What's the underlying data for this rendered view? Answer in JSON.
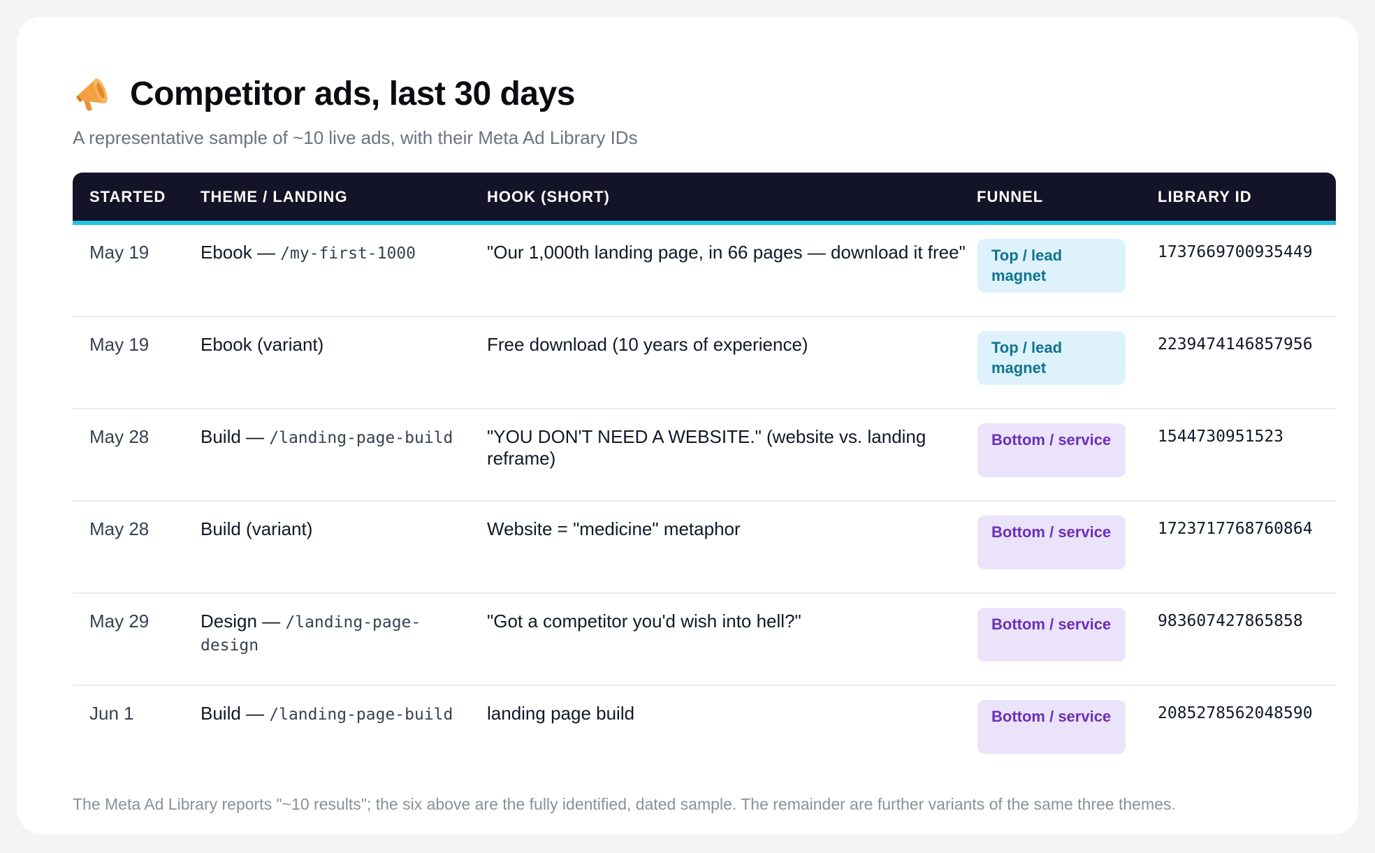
{
  "header": {
    "icon": "megaphone-icon",
    "title": "Competitor ads, last 30 days",
    "subtitle": "A representative sample of ~10 live ads, with their Meta Ad Library IDs"
  },
  "table": {
    "columns": [
      "STARTED",
      "THEME / LANDING",
      "HOOK (SHORT)",
      "FUNNEL",
      "LIBRARY ID"
    ],
    "rows": [
      {
        "started": "May 19",
        "theme": "Ebook — ",
        "landing": "/my-first-1000",
        "hook": "\"Our 1,000th landing page, in 66 pages — download it free\"",
        "funnel": "Top / lead magnet",
        "funnel_type": "top",
        "library_id": "1737669700935449"
      },
      {
        "started": "May 19",
        "theme": "Ebook (variant)",
        "landing": "",
        "hook": "Free download (10 years of experience)",
        "funnel": "Top / lead magnet",
        "funnel_type": "top",
        "library_id": "2239474146857956"
      },
      {
        "started": "May 28",
        "theme": "Build — ",
        "landing": "/landing-page-build",
        "hook": "\"YOU DON'T NEED A WEBSITE.\" (website vs. landing reframe)",
        "funnel": "Bottom / service",
        "funnel_type": "bottom",
        "library_id": "1544730951523"
      },
      {
        "started": "May 28",
        "theme": "Build (variant)",
        "landing": "",
        "hook": "Website = \"medicine\" metaphor",
        "funnel": "Bottom / service",
        "funnel_type": "bottom",
        "library_id": "1723717768760864"
      },
      {
        "started": "May 29",
        "theme": "Design — ",
        "landing": "/landing-page-design",
        "hook": "\"Got a competitor you'd wish into hell?\"",
        "funnel": "Bottom / service",
        "funnel_type": "bottom",
        "library_id": "983607427865858"
      },
      {
        "started": "Jun 1",
        "theme": "Build — ",
        "landing": "/landing-page-build",
        "hook": "landing page build",
        "funnel": "Bottom / service",
        "funnel_type": "bottom",
        "library_id": "2085278562048590"
      }
    ]
  },
  "footnote": "The Meta Ad Library reports \"~10 results\"; the six above are the fully identified, dated sample. The remainder are further variants of the same three themes.",
  "colors": {
    "header_bg": "#141428",
    "header_accent": "#22c3e6",
    "top_badge_bg": "#def2fb",
    "top_badge_text": "#0e7490",
    "bottom_badge_bg": "#ebe3fa",
    "bottom_badge_text": "#6b2fb8"
  }
}
